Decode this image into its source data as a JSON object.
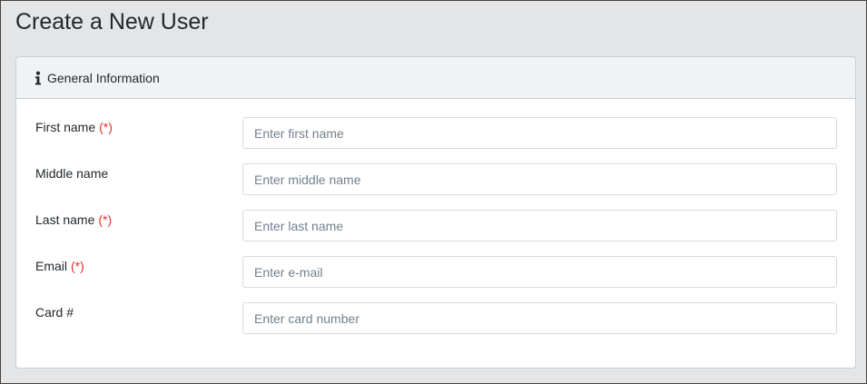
{
  "page": {
    "title": "Create a New User"
  },
  "card": {
    "header_icon": "info-icon",
    "header_label": "General Information"
  },
  "form": {
    "required_marker": "(*)",
    "fields": [
      {
        "label": "First name",
        "required": true,
        "value": "",
        "placeholder": "Enter first name"
      },
      {
        "label": "Middle name",
        "required": false,
        "value": "",
        "placeholder": "Enter middle name"
      },
      {
        "label": "Last name",
        "required": true,
        "value": "",
        "placeholder": "Enter last name"
      },
      {
        "label": "Email",
        "required": true,
        "value": "",
        "placeholder": "Enter e-mail"
      },
      {
        "label": "Card #",
        "required": false,
        "value": "",
        "placeholder": "Enter card number"
      }
    ]
  },
  "colors": {
    "background": "#e4e5e6",
    "card_header": "#f0f3f5",
    "required": "#e02f2f",
    "border": "#c8ced3"
  }
}
